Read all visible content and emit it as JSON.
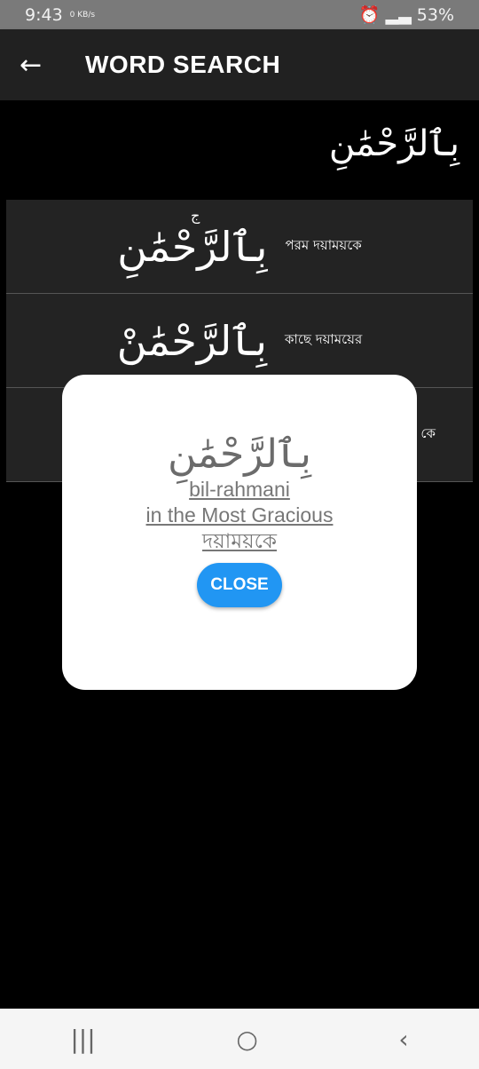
{
  "status_bar": {
    "time": "9:43",
    "net_speed": "0 KB/s",
    "battery": "53%"
  },
  "app_bar": {
    "title": "WORD SEARCH",
    "back_icon": "arrow-left-icon"
  },
  "search_word": "بِٱلرَّحْمَٰنِ",
  "results": [
    {
      "arabic": "بِٱلرَّحْمَٰنِ",
      "mark": "ج",
      "bengali": "পরম দয়াময়কে"
    },
    {
      "arabic": "بِٱلرَّحْمَٰنْ",
      "bengali": "কাছে দয়াময়ের"
    },
    {
      "arabic": "",
      "bengali": "কে"
    }
  ],
  "dialog": {
    "arabic": "بِٱلرَّحْمَٰنِ",
    "transliteration": "bil-rahmani",
    "english": "in the Most Gracious",
    "bengali": "দয়াময়কে",
    "close_label": "CLOSE",
    "close_color": "#2196f3"
  },
  "nav": {
    "recents": "|||",
    "home": "○",
    "back": "‹"
  }
}
